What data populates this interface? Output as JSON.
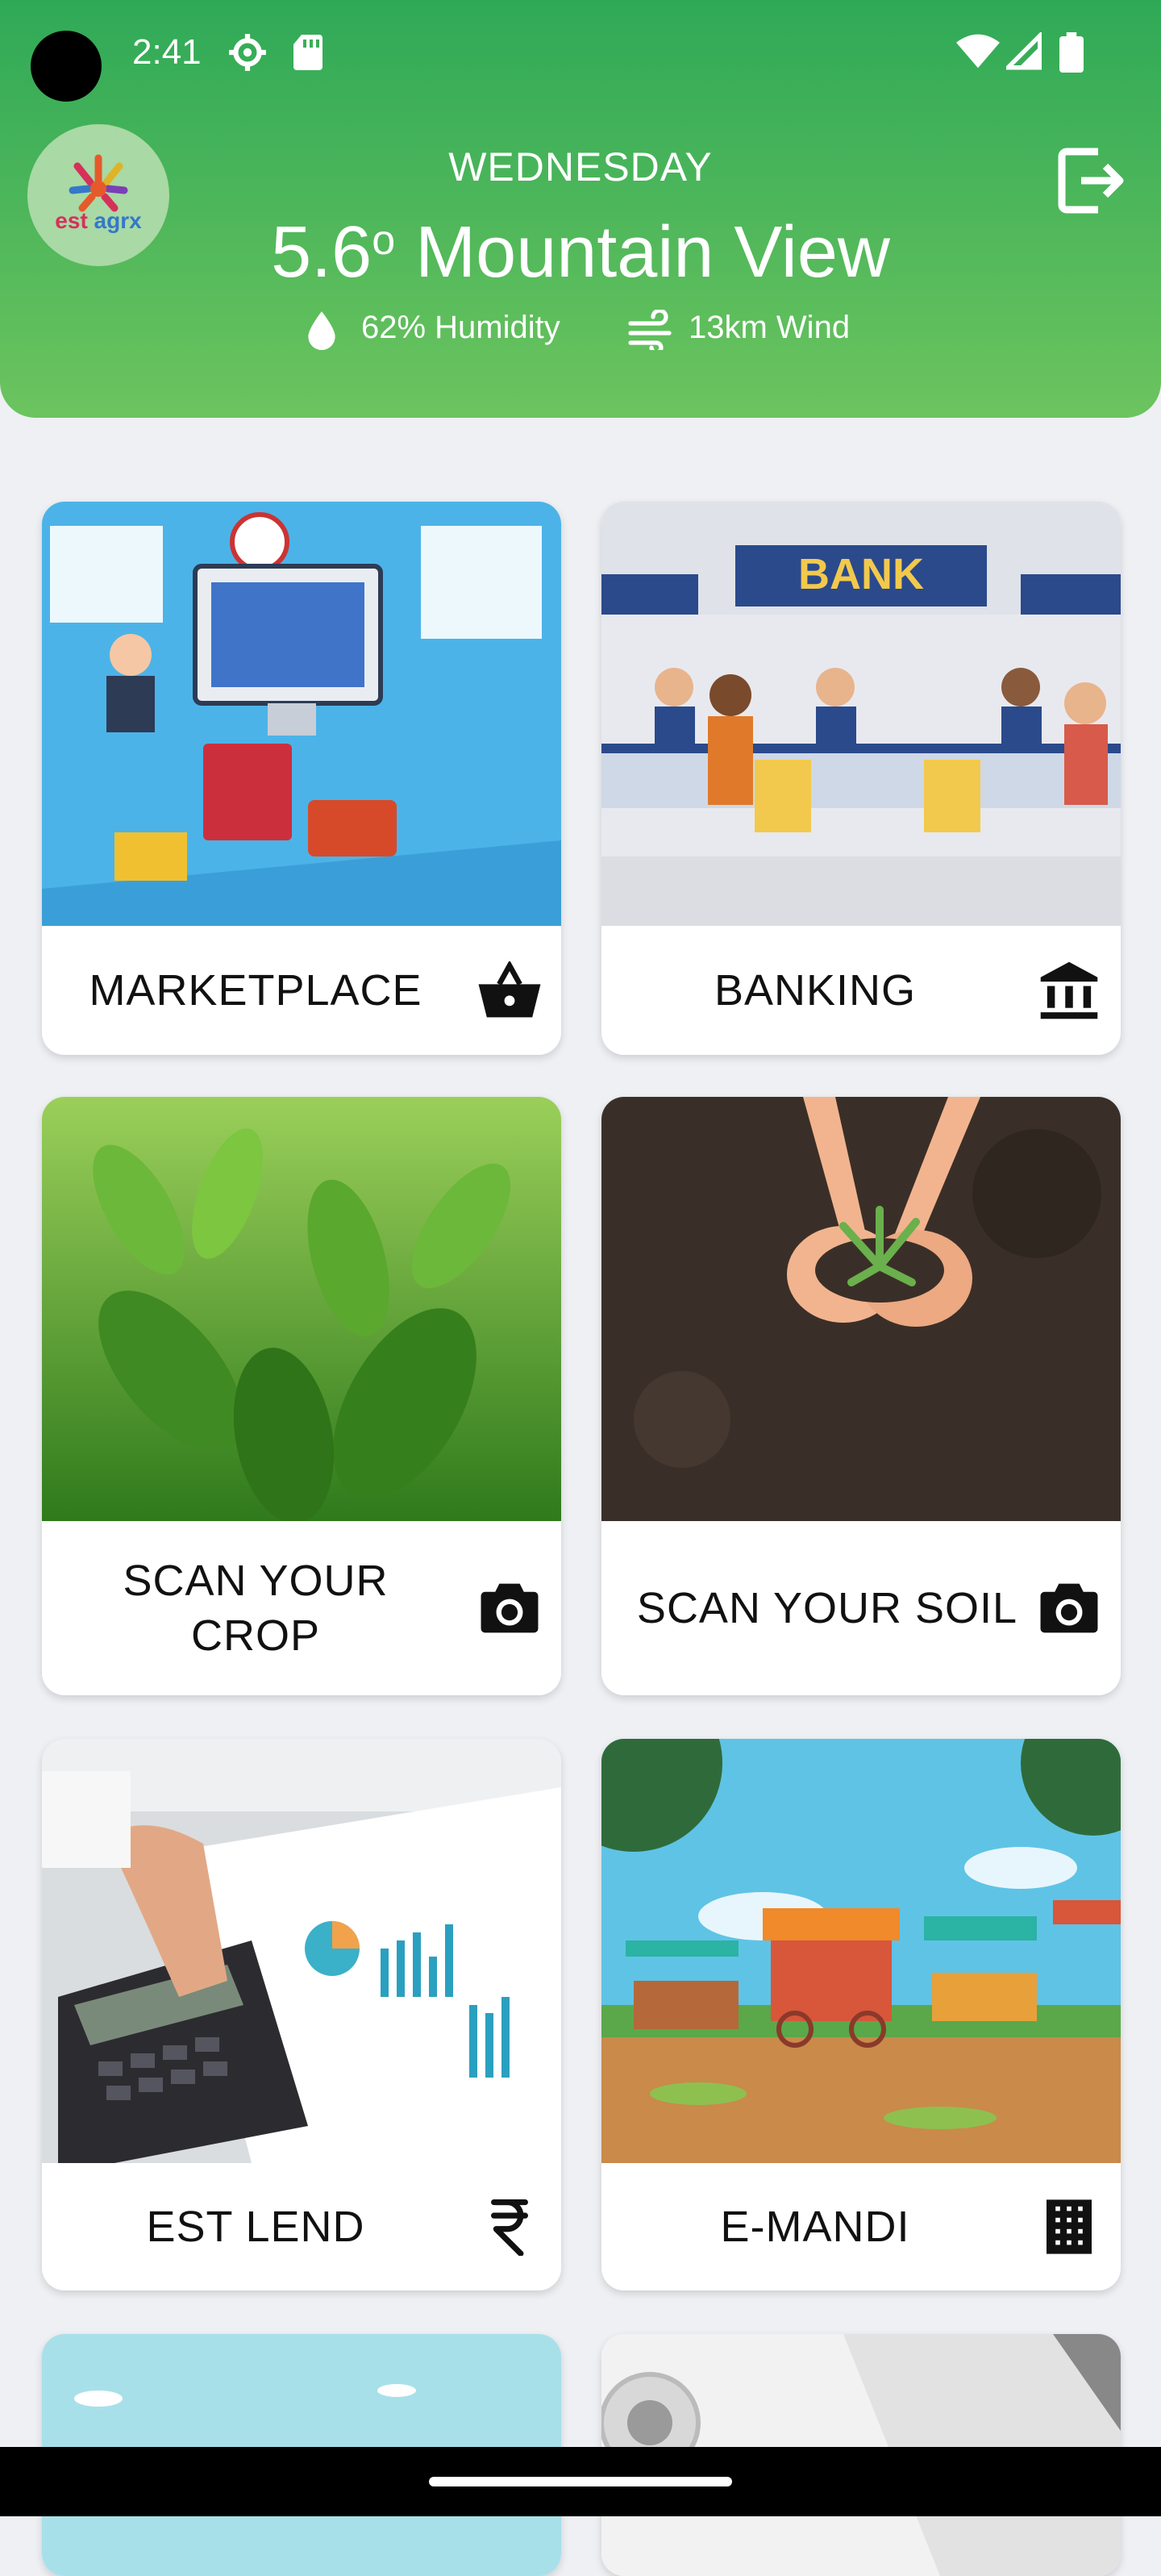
{
  "status_bar": {
    "time": "2:41",
    "icons": [
      "settings-icon",
      "sd-card-icon",
      "wifi-icon",
      "signal-icon",
      "battery-icon"
    ]
  },
  "header": {
    "logo": {
      "text_part1": "est",
      "text_part2": "agrx"
    },
    "day": "WEDNESDAY",
    "temperature": "5.6",
    "degree_symbol": "o",
    "location": "Mountain View",
    "humidity": "62% Humidity",
    "wind": "13km Wind",
    "gradient_top": "#2fa957",
    "gradient_bottom": "#6cc45e"
  },
  "tiles": [
    {
      "label": "MARKETPLACE",
      "icon": "basket-icon"
    },
    {
      "label": "BANKING",
      "icon": "bank-icon"
    },
    {
      "label": "SCAN YOUR CROP",
      "icon": "camera-icon"
    },
    {
      "label": "SCAN YOUR SOIL",
      "icon": "camera-icon"
    },
    {
      "label": "EST LEND",
      "icon": "rupee-icon"
    },
    {
      "label": "E-MANDI",
      "icon": "grid-icon"
    }
  ]
}
